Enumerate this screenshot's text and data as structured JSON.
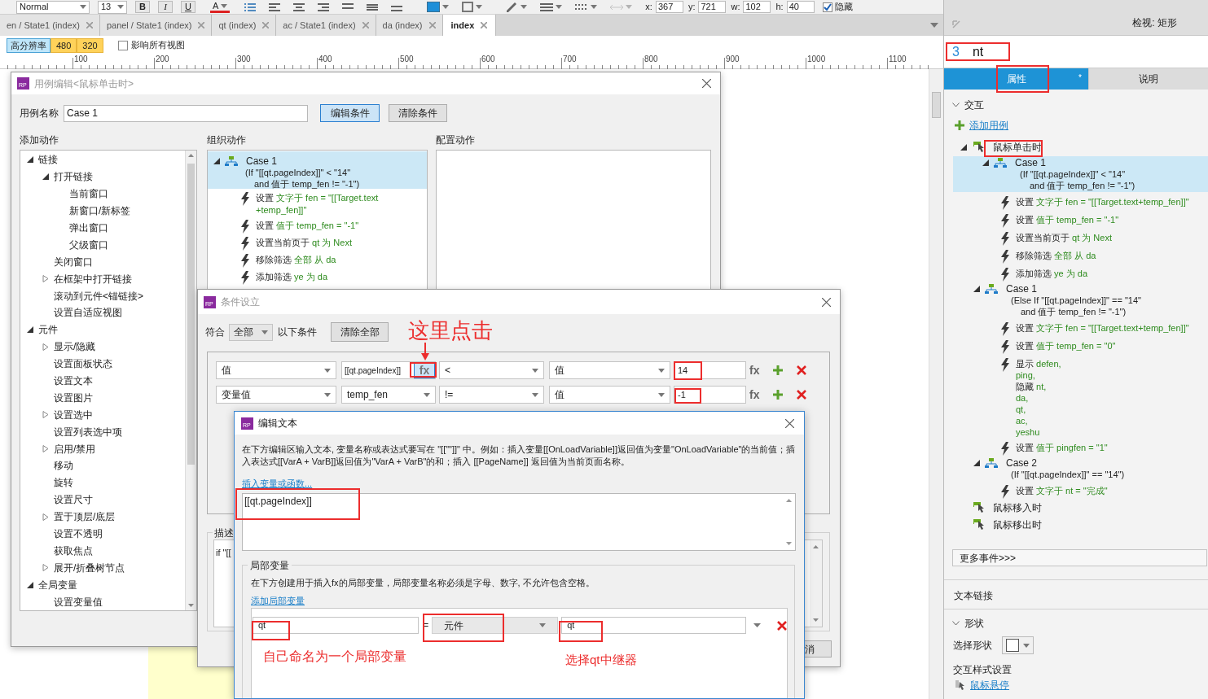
{
  "toolbar": {
    "font_style": "Normal",
    "font_size": "13",
    "format_buttons": [
      "B",
      "I",
      "U"
    ],
    "text_color_glyph": "A",
    "coords": [
      {
        "label": "x:",
        "value": "367"
      },
      {
        "label": "y:",
        "value": "721"
      },
      {
        "label": "w:",
        "value": "102"
      },
      {
        "label": "h:",
        "value": "40"
      }
    ],
    "hidden": {
      "label": "隐藏",
      "checked": true
    }
  },
  "tabs": [
    {
      "label": "en / State1 (index)",
      "selected": false
    },
    {
      "label": "panel / State1 (index)",
      "selected": false
    },
    {
      "label": "qt (index)",
      "selected": false
    },
    {
      "label": "ac / State1 (index)",
      "selected": false
    },
    {
      "label": "da (index)",
      "selected": false
    },
    {
      "label": "index",
      "selected": true
    }
  ],
  "views": {
    "items": [
      {
        "label": "高分辨率",
        "selected": true
      },
      {
        "label": "480",
        "selected": false
      },
      {
        "label": "320",
        "selected": false
      }
    ],
    "affect_all": {
      "label": "影响所有视图",
      "checked": false
    }
  },
  "ruler": [
    "100",
    "200",
    "300",
    "400",
    "500",
    "600",
    "700",
    "800",
    "900",
    "1000",
    "1100"
  ],
  "case_editor": {
    "logo": "RP",
    "title": "用例编辑<鼠标单击时>",
    "name_label": "用例名称",
    "name_value": "Case 1",
    "buttons": [
      {
        "label": "编辑条件",
        "selected": true
      },
      {
        "label": "清除条件",
        "selected": false
      }
    ],
    "columns": [
      "添加动作",
      "组织动作",
      "配置动作"
    ],
    "actions_tree": [
      {
        "label": "链接",
        "kind": "group",
        "expanded": true,
        "children": [
          {
            "label": "打开链接",
            "kind": "group",
            "expanded": true,
            "children": [
              {
                "label": "当前窗口",
                "kind": "action"
              },
              {
                "label": "新窗口/新标签",
                "kind": "action"
              },
              {
                "label": "弹出窗口",
                "kind": "action"
              },
              {
                "label": "父级窗口",
                "kind": "action"
              }
            ]
          },
          {
            "label": "关闭窗口",
            "kind": "action"
          },
          {
            "label": "在框架中打开链接",
            "kind": "group",
            "expanded": false
          },
          {
            "label": "滚动到元件<锚链接>",
            "kind": "action"
          },
          {
            "label": "设置自适应视图",
            "kind": "action"
          }
        ]
      },
      {
        "label": "元件",
        "kind": "group",
        "expanded": true,
        "children": [
          {
            "label": "显示/隐藏",
            "kind": "group",
            "expanded": false
          },
          {
            "label": "设置面板状态",
            "kind": "action"
          },
          {
            "label": "设置文本",
            "kind": "action"
          },
          {
            "label": "设置图片",
            "kind": "action"
          },
          {
            "label": "设置选中",
            "kind": "group",
            "expanded": false
          },
          {
            "label": "设置列表选中项",
            "kind": "action"
          },
          {
            "label": "启用/禁用",
            "kind": "group",
            "expanded": false
          },
          {
            "label": "移动",
            "kind": "action"
          },
          {
            "label": "旋转",
            "kind": "action"
          },
          {
            "label": "设置尺寸",
            "kind": "action"
          },
          {
            "label": "置于顶层/底层",
            "kind": "group",
            "expanded": false
          },
          {
            "label": "设置不透明",
            "kind": "action"
          },
          {
            "label": "获取焦点",
            "kind": "action"
          },
          {
            "label": "展开/折叠树节点",
            "kind": "group",
            "expanded": false
          }
        ]
      },
      {
        "label": "全局变量",
        "kind": "group",
        "expanded": true,
        "children": [
          {
            "label": "设置变量值",
            "kind": "action"
          }
        ]
      }
    ],
    "organized": {
      "name": "Case 1",
      "selected": true,
      "expanded": true,
      "condition": [
        "(If \"[[qt.pageIndex]]\" < \"14\"",
        "and 值于 temp_fen != \"-1\")"
      ],
      "actions": [
        {
          "lines": [
            {
              "verb": "设置",
              "detail": "文字于 fen = \"[[Target.text"
            },
            {
              "detail": "+temp_fen]]\""
            }
          ]
        },
        {
          "lines": [
            {
              "verb": "设置",
              "detail": "值于 temp_fen = \"-1\""
            }
          ]
        },
        {
          "lines": [
            {
              "verb": "设置当前页于",
              "detail": "qt 为 Next"
            }
          ]
        },
        {
          "lines": [
            {
              "verb": "移除筛选",
              "detail": "全部 从 da"
            }
          ]
        },
        {
          "lines": [
            {
              "verb": "添加筛选",
              "detail": "ye 为 da"
            }
          ]
        }
      ]
    }
  },
  "condition_dialog": {
    "logo": "RP",
    "title": "条件设立",
    "match_label": "符合",
    "match_value": "全部",
    "match_suffix": "以下条件",
    "clear_button": "清除全部",
    "conditions": [
      {
        "kind": "value",
        "source": "值",
        "expr": "[[qt.pageIndex]]",
        "expr_fx": "fx",
        "operator": "<",
        "target_source": "值",
        "target": "14",
        "target_fx": "fx"
      },
      {
        "kind": "variable",
        "source": "变量值",
        "variable": "temp_fen",
        "operator": "!=",
        "target_source": "值",
        "target": "-1",
        "target_fx": "fx"
      }
    ],
    "description_label": "描述",
    "description_text": "if \"[[",
    "cancel_button": "消"
  },
  "edit_text_dialog": {
    "logo": "RP",
    "title": "编辑文本",
    "hint": "在下方编辑区输入文本, 变量名称或表达式要写在 \"[[\"\"]]\" 中。例如：插入变量[[OnLoadVariable]]返回值为变量\"OnLoadVariable\"的当前值；插入表达式[[VarA + VarB]]返回值为\"VarA + VarB\"的和；插入 [[PageName]] 返回值为当前页面名称。",
    "insert_link": "插入变量或函数...",
    "text_value": "[[qt.pageIndex]]",
    "locals": {
      "legend": "局部变量",
      "hint": "在下方创建用于插入fx的局部变量，局部变量名称必须是字母、数字, 不允许包含空格。",
      "add_link": "添加局部变量",
      "rows": [
        {
          "name": "qt",
          "equals": "=",
          "type": "元件",
          "target": "qt"
        }
      ]
    }
  },
  "annotations": [
    "这里点击",
    "自己命名为一个局部变量",
    "选择qt中继器"
  ],
  "inspector": {
    "header": "检视: 矩形",
    "widget_number": "3",
    "widget_name": "nt",
    "tabs": [
      {
        "label": "属性",
        "selected": true,
        "badge": "*"
      },
      {
        "label": "说明",
        "selected": false
      }
    ],
    "interaction": {
      "title": "交互",
      "expanded": true,
      "add_case": "添加用例",
      "events": [
        {
          "label": "鼠标单击时",
          "expanded": true,
          "cases": [
            {
              "name": "Case 1",
              "selected": true,
              "expanded": true,
              "condition": [
                "(If \"[[qt.pageIndex]]\" < \"14\"",
                "and 值于 temp_fen != \"-1\")"
              ],
              "actions": [
                {
                  "lines": [
                    {
                      "verb": "设置",
                      "detail": "文字于 fen = \"[[Target.text+temp_fen]]\""
                    }
                  ]
                },
                {
                  "lines": [
                    {
                      "verb": "设置",
                      "detail": "值于 temp_fen = \"-1\""
                    }
                  ]
                },
                {
                  "lines": [
                    {
                      "verb": "设置当前页于",
                      "detail": "qt 为 Next"
                    }
                  ]
                },
                {
                  "lines": [
                    {
                      "verb": "移除筛选",
                      "detail": "全部 从 da"
                    }
                  ]
                },
                {
                  "lines": [
                    {
                      "verb": "添加筛选",
                      "detail": "ye 为 da"
                    }
                  ]
                }
              ]
            },
            {
              "name": "Case 1",
              "selected": false,
              "expanded": true,
              "condition": [
                "(Else If \"[[qt.pageIndex]]\" == \"14\"",
                "and 值于 temp_fen != \"-1\")"
              ],
              "actions": [
                {
                  "lines": [
                    {
                      "verb": "设置",
                      "detail": "文字于 fen = \"[[Target.text+temp_fen]]\""
                    }
                  ]
                },
                {
                  "lines": [
                    {
                      "verb": "设置",
                      "detail": "值于 temp_fen = \"0\""
                    }
                  ]
                },
                {
                  "lines": [
                    {
                      "verb": "显示",
                      "detail": "defen,"
                    },
                    {
                      "detail": "ping,"
                    },
                    {
                      "verb": "隐藏",
                      "detail": "nt,"
                    },
                    {
                      "detail": "da,"
                    },
                    {
                      "detail": "qt,"
                    },
                    {
                      "detail": "ac,"
                    },
                    {
                      "detail": "yeshu"
                    }
                  ]
                },
                {
                  "lines": [
                    {
                      "verb": "设置",
                      "detail": "值于 pingfen = \"1\""
                    }
                  ]
                }
              ]
            },
            {
              "name": "Case 2",
              "selected": false,
              "expanded": true,
              "condition": [
                "(If \"[[qt.pageIndex]]\" == \"14\")"
              ],
              "actions": [
                {
                  "lines": [
                    {
                      "verb": "设置",
                      "detail": "文字于 nt = \"完成\""
                    }
                  ]
                }
              ]
            }
          ]
        },
        {
          "label": "鼠标移入时"
        },
        {
          "label": "鼠标移出时"
        }
      ],
      "more_events": "更多事件>>>"
    },
    "text_link": "文本链接",
    "shape": {
      "title": "形状",
      "expanded": true,
      "select_label": "选择形状"
    },
    "style_title": "交互样式设置",
    "hover_link": "鼠标悬停"
  }
}
